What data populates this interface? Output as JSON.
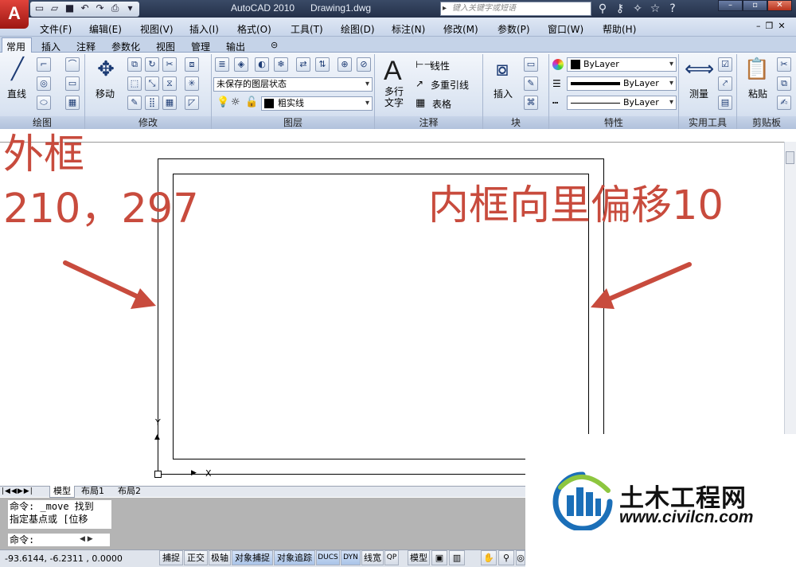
{
  "titlebar": {
    "app_logo": "A",
    "title": "AutoCAD 2010      Drawing1.dwg",
    "search_placeholder": "键入关键字或短语",
    "qat_icons": [
      "new-icon",
      "open-icon",
      "save-icon",
      "undo-icon",
      "redo-icon",
      "plot-icon",
      "dropdown-icon"
    ],
    "title_icons": [
      "binoculars-icon",
      "key-icon",
      "satellite-icon",
      "star-icon",
      "help-icon"
    ]
  },
  "menu": [
    "文件(F)",
    "编辑(E)",
    "视图(V)",
    "插入(I)",
    "格式(O)",
    "工具(T)",
    "绘图(D)",
    "标注(N)",
    "修改(M)",
    "参数(P)",
    "窗口(W)",
    "帮助(H)"
  ],
  "ribbon_tabs": [
    "常用",
    "插入",
    "注释",
    "参数化",
    "视图",
    "管理",
    "输出"
  ],
  "ribbon": {
    "draw": {
      "line_label": "直线",
      "panel": "绘图"
    },
    "modify": {
      "move_label": "移动",
      "panel": "修改"
    },
    "layers": {
      "state": "未保存的图层状态",
      "current_layer": "粗实线",
      "panel": "图层"
    },
    "annotation": {
      "mtext_label": "多行文字",
      "dim_label": "线性",
      "leader_label": "多重引线",
      "table_label": "表格",
      "panel": "注释"
    },
    "block": {
      "insert_label": "插入",
      "panel": "块"
    },
    "properties": {
      "color": "ByLayer",
      "linetype": "ByLayer",
      "lineweight": "ByLayer",
      "panel": "特性"
    },
    "utilities": {
      "measure_label": "测量",
      "panel": "实用工具"
    },
    "clipboard": {
      "paste_label": "粘贴",
      "panel": "剪贴板"
    }
  },
  "drawing": {
    "annotation_left_1": "外框",
    "annotation_left_2": "210，297",
    "annotation_right": "内框向里偏移10",
    "ucs_x": "X",
    "ucs_y": "Y",
    "annotation_color": "#c84b3d"
  },
  "layout_tabs": [
    "模型",
    "布局1",
    "布局2"
  ],
  "command": {
    "history": [
      "命令:  _move 找到",
      "指定基点或 [位移"
    ],
    "prompt": "命令:"
  },
  "status": {
    "coords": "-93.6144, -6.2311 , 0.0000",
    "buttons": [
      "捕捉",
      "正交",
      "极轴",
      "对象捕捉",
      "对象追踪",
      "DUCS",
      "DYN",
      "线宽",
      "QP"
    ],
    "model_label": "模型"
  },
  "watermark": {
    "name": "土木工程网",
    "url": "www.civilcn.com"
  }
}
